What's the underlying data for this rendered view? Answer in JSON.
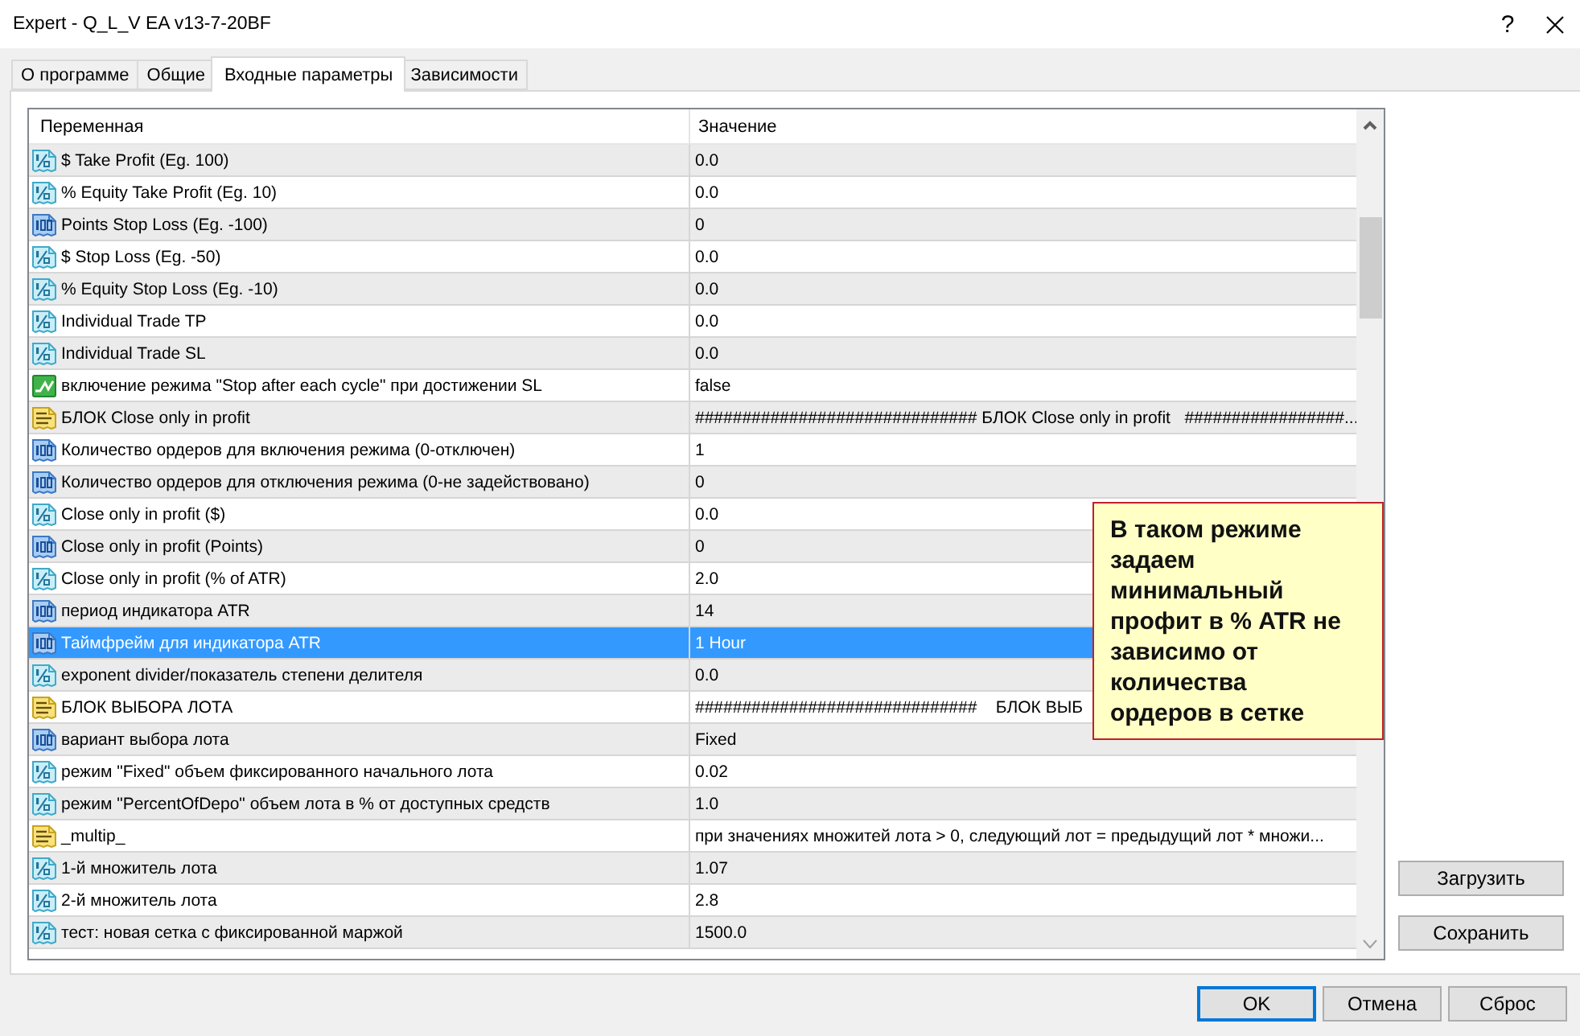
{
  "window": {
    "title": "Expert - Q_L_V EA v13-7-20BF",
    "help_label": "?"
  },
  "tabs": [
    {
      "label": "О программе",
      "selected": false
    },
    {
      "label": "Общие",
      "selected": false
    },
    {
      "label": "Входные параметры",
      "selected": true
    },
    {
      "label": "Зависимости",
      "selected": false
    }
  ],
  "table": {
    "columns": [
      "Переменная",
      "Значение"
    ],
    "rows": [
      {
        "kind": "double",
        "name": "$ Take Profit (Eg. 100)",
        "value": "0.0",
        "selected": false
      },
      {
        "kind": "double",
        "name": "% Equity Take Profit (Eg. 10)",
        "value": "0.0",
        "selected": false
      },
      {
        "kind": "int",
        "name": "Points Stop Loss (Eg. -100)",
        "value": "0",
        "selected": false
      },
      {
        "kind": "double",
        "name": "$ Stop Loss (Eg. -50)",
        "value": "0.0",
        "selected": false
      },
      {
        "kind": "double",
        "name": "% Equity Stop Loss (Eg. -10)",
        "value": "0.0",
        "selected": false
      },
      {
        "kind": "double",
        "name": "Individual Trade TP",
        "value": "0.0",
        "selected": false
      },
      {
        "kind": "double",
        "name": "Individual Trade SL",
        "value": "0.0",
        "selected": false
      },
      {
        "kind": "bool",
        "name": "включение режима \"Stop after each cycle\" при достижении SL",
        "value": "false",
        "selected": false
      },
      {
        "kind": "string",
        "name": "БЛОК Close only in profit",
        "value": "############################## БЛОК Close only in profit   #################...",
        "selected": false
      },
      {
        "kind": "int",
        "name": "Количество ордеров для включения режима (0-отключен)",
        "value": "1",
        "selected": false
      },
      {
        "kind": "int",
        "name": "Количество ордеров для отключения режима (0-не задействовано)",
        "value": "0",
        "selected": false
      },
      {
        "kind": "double",
        "name": "Close only in profit ($)",
        "value": "0.0",
        "selected": false
      },
      {
        "kind": "int",
        "name": "Close only in profit (Points)",
        "value": "0",
        "selected": false
      },
      {
        "kind": "double",
        "name": "Close only in profit (% of ATR)",
        "value": "2.0",
        "selected": false
      },
      {
        "kind": "int",
        "name": "период индикатора ATR",
        "value": "14",
        "selected": false
      },
      {
        "kind": "int",
        "name": "Таймфрейм для индикатора ATR",
        "value": "1 Hour",
        "selected": true
      },
      {
        "kind": "double",
        "name": "exponent divider/показатель степени делителя",
        "value": "0.0",
        "selected": false
      },
      {
        "kind": "string",
        "name": "БЛОК ВЫБОРА ЛОТА",
        "value": "##############################    БЛОК ВЫБ",
        "selected": false
      },
      {
        "kind": "int",
        "name": "вариант выбора лота",
        "value": "Fixed",
        "selected": false
      },
      {
        "kind": "double",
        "name": "режим \"Fixed\" объем фиксированного начального лота",
        "value": "0.02",
        "selected": false
      },
      {
        "kind": "double",
        "name": "режим \"PercentOfDepo\" объем лота в % от доступных средств",
        "value": "1.0",
        "selected": false
      },
      {
        "kind": "string",
        "name": "_multip_",
        "value": "при значениях множитей лота > 0, следующий лот = предыдущий лот * множи...",
        "selected": false
      },
      {
        "kind": "double",
        "name": "1-й множитель лота",
        "value": "1.07",
        "selected": false
      },
      {
        "kind": "double",
        "name": "2-й множитель лота",
        "value": "2.8",
        "selected": false
      },
      {
        "kind": "double",
        "name": "тест: новая сетка с фиксированной маржой",
        "value": "1500.0",
        "selected": false
      }
    ]
  },
  "tooltip": {
    "text": "В таком режиме задаем минимальный профит в % ATR не зависимо от количества ордеров в сетке"
  },
  "side_buttons": [
    "Загрузить",
    "Сохранить"
  ],
  "buttons": [
    {
      "label": "OK",
      "default": true
    },
    {
      "label": "Отмена",
      "default": false
    },
    {
      "label": "Сброс",
      "default": false
    }
  ]
}
